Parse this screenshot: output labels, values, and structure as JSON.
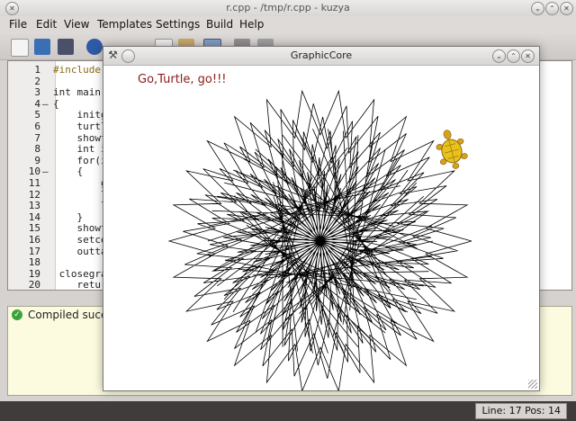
{
  "window": {
    "title": "r.cpp - /tmp/r.cpp - kuzya"
  },
  "menu": [
    "File",
    "Edit",
    "View",
    "Templates",
    "Settings",
    "Build",
    "Help"
  ],
  "editor": {
    "line_numbers": [
      "1",
      "2",
      "3",
      "4",
      "5",
      "6",
      "7",
      "8",
      "9",
      "10",
      "11",
      "12",
      "13",
      "14",
      "15",
      "16",
      "17",
      "18",
      "19",
      "20"
    ],
    "lines": [
      "#include",
      "",
      "int main(",
      "{",
      "    initg",
      "    turtl",
      "    showt",
      "    int i",
      "    for(i",
      "    {",
      "        g",
      "        l",
      "        l",
      "    }",
      "    showt",
      "    setco",
      "    outta",
      "",
      " closegra",
      "    retur"
    ]
  },
  "output": {
    "message": "Compiled success"
  },
  "status": {
    "position": "Line: 17 Pos: 14"
  },
  "graphic_window": {
    "title": "GraphicCore",
    "text": "Go,Turtle, go!!!"
  },
  "colors": {
    "pen": "#000000",
    "text_accent": "#8b1a1a",
    "turtle": "#e8c21a",
    "output_bg": "#fcfbe0"
  },
  "icons": [
    "new-file-icon",
    "open-file-icon",
    "save-icon",
    "undo-icon",
    "redo-icon",
    "cut-icon",
    "copy-icon",
    "paste-icon",
    "compile-icon",
    "run-icon",
    "stop-icon"
  ]
}
